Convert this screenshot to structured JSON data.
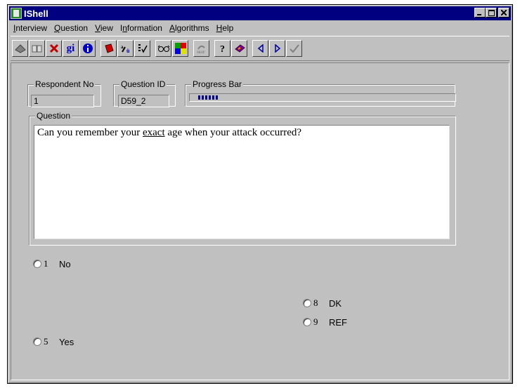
{
  "window": {
    "title": "IShell"
  },
  "menu": [
    {
      "label": "Interview",
      "u": "I"
    },
    {
      "label": "Question",
      "u": "Q"
    },
    {
      "label": "View",
      "u": "V"
    },
    {
      "label": "Information",
      "u": "n"
    },
    {
      "label": "Algorithms",
      "u": "A"
    },
    {
      "label": "Help",
      "u": "H"
    }
  ],
  "toolbar": {
    "buttons": [
      "book",
      "open-book",
      "red-x",
      "gi",
      "info",
      "red-book",
      "spell-check",
      "checklist",
      "glasses",
      "color-palette",
      "skip",
      "help-question",
      "help-book",
      "nav-previous",
      "nav-next",
      "check"
    ],
    "gi_label": "gi"
  },
  "fields": {
    "respondent_label": "Respondent No",
    "respondent_value": "1",
    "question_id_label": "Question ID",
    "question_id_value": "D59_2",
    "progress_label": "Progress Bar",
    "progress_fraction": 0.05,
    "question_label": "Question"
  },
  "question": {
    "before": "Can you remember your ",
    "emph": "exact",
    "after": " age when your attack occurred?"
  },
  "answers": [
    {
      "code": "1",
      "label": "No"
    },
    {
      "code": "8",
      "label": "DK"
    },
    {
      "code": "9",
      "label": "REF"
    },
    {
      "code": "5",
      "label": "Yes"
    }
  ],
  "colors": {
    "titlebar": "#000080",
    "face": "#c0c0c0",
    "progress": "#000080"
  }
}
